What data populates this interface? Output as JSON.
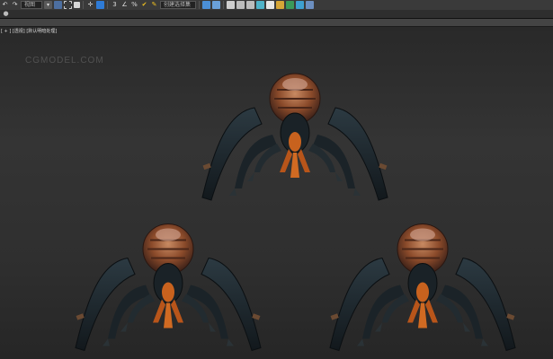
{
  "toolbar": {
    "selection_set_value": "视图",
    "selection_filter_value": "创建选择集",
    "snap_label": "3"
  },
  "viewport": {
    "label": "[ + ] [透视] [默认明暗处理]",
    "watermark": "CGMODEL.COM"
  },
  "colors": {
    "toolbar_bg": "#3a3a3a",
    "viewport_bg": "#2f2f2f",
    "spider_body": "#1b2328",
    "spider_abdomen": "#8a4a2a",
    "spider_orange": "#c8621e"
  },
  "icons": [
    "undo-icon",
    "redo-icon",
    "link-icon",
    "unlink-icon",
    "bind-icon",
    "select-icon",
    "select-name-icon",
    "rect-select-icon",
    "window-icon",
    "move-icon",
    "rotate-icon",
    "scale-icon",
    "snap-icon",
    "angle-snap-icon",
    "percent-snap-icon",
    "spinner-snap-icon",
    "edit-named-set-icon",
    "mirror-icon",
    "align-icon",
    "layer-icon",
    "ribbon-icon",
    "curve-editor-icon",
    "schematic-icon",
    "material-editor-icon",
    "render-setup-icon",
    "render-frame-icon",
    "render-icon"
  ]
}
